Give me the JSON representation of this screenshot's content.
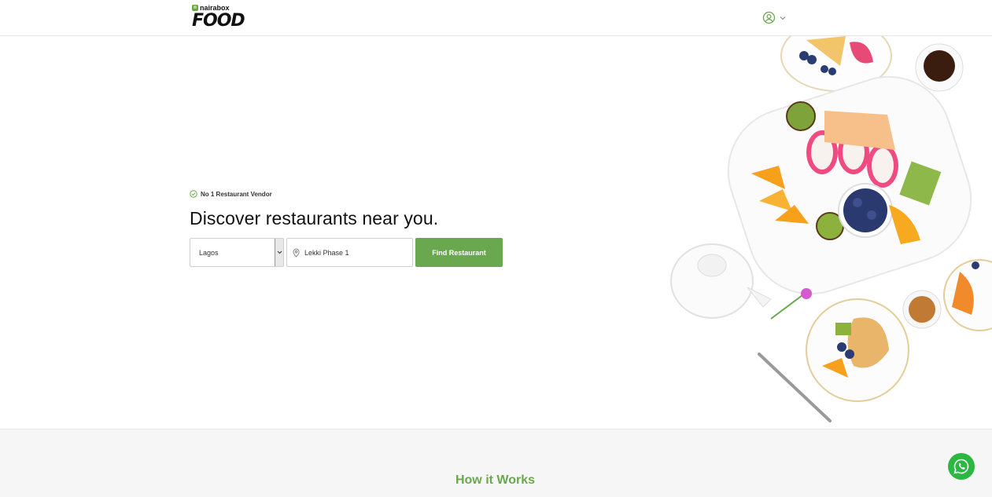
{
  "header": {
    "brand_top": "nairabox",
    "brand_main": "FOOD",
    "user_icon": "user-circle-icon",
    "chevron_icon": "chevron-down-icon"
  },
  "hero": {
    "badge_text": "No 1 Restaurant Vendor",
    "headline": "Discover restaurants near you.",
    "city_select_value": "Lagos",
    "location_value": "Lekki Phase 1",
    "find_button": "Find Restaurant"
  },
  "how_it_works": {
    "title": "How it Works"
  },
  "colors": {
    "accent": "#6aa84f",
    "whatsapp": "#2bb741"
  }
}
